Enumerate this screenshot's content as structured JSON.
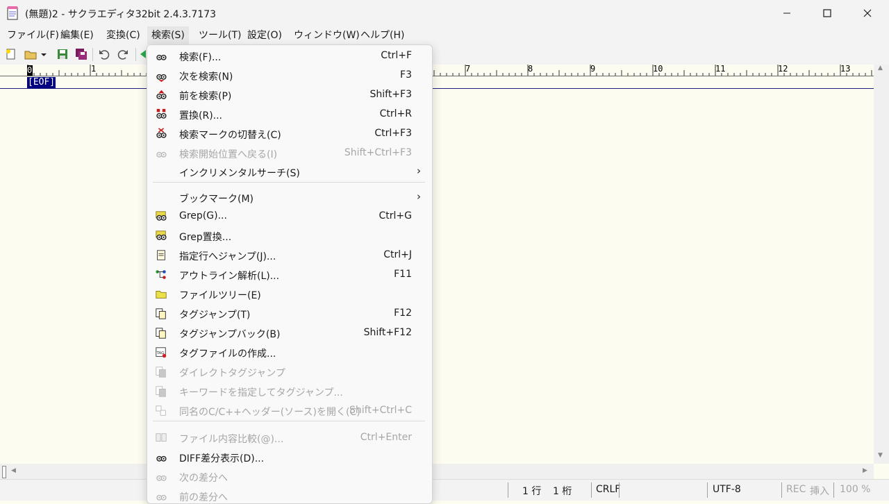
{
  "window": {
    "title": "(無題)2 - サクラエディタ32bit 2.4.3.7173",
    "minimize_icon": "minimize-icon",
    "maximize_icon": "maximize-icon",
    "close_icon": "close-icon"
  },
  "menubar": {
    "items": [
      "ファイル(F)",
      "編集(E)",
      "変換(C)",
      "検索(S)",
      "ツール(T)",
      "設定(O)",
      "ウィンドウ(W)",
      "ヘルプ(H)"
    ],
    "active_index": 3
  },
  "toolbar": {
    "icons": [
      "new-file-icon",
      "open-file-icon",
      "dropdown-arrow-icon",
      "save-icon",
      "save-all-icon",
      "undo-icon",
      "redo-icon",
      "jump-back-icon"
    ]
  },
  "ruler": {
    "cursor_label": "0",
    "labels": [
      "1",
      "7",
      "8",
      "9",
      "10",
      "11",
      "12",
      "13"
    ]
  },
  "editor": {
    "eof_marker": "[EOF]",
    "background": "#fdfcf0",
    "eof_bg": "#000080"
  },
  "search_menu": {
    "items": [
      {
        "label": "検索(F)...",
        "shortcut": "Ctrl+F",
        "icon": "find-icon",
        "enabled": true
      },
      {
        "label": "次を検索(N)",
        "shortcut": "F3",
        "icon": "find-next-icon",
        "enabled": true
      },
      {
        "label": "前を検索(P)",
        "shortcut": "Shift+F3",
        "icon": "find-prev-icon",
        "enabled": true
      },
      {
        "label": "置換(R)...",
        "shortcut": "Ctrl+R",
        "icon": "replace-icon",
        "enabled": true
      },
      {
        "label": "検索マークの切替え(C)",
        "shortcut": "Ctrl+F3",
        "icon": "toggle-search-mark-icon",
        "enabled": true
      },
      {
        "label": "検索開始位置へ戻る(I)",
        "shortcut": "Shift+Ctrl+F3",
        "icon": "search-start-icon",
        "enabled": false
      },
      {
        "label": "インクリメンタルサーチ(S)",
        "shortcut": "",
        "icon": "",
        "enabled": true,
        "submenu": true
      },
      {
        "label": "ブックマーク(M)",
        "shortcut": "",
        "icon": "",
        "enabled": true,
        "submenu": true
      },
      {
        "label": "Grep(G)...",
        "shortcut": "Ctrl+G",
        "icon": "grep-icon",
        "enabled": true
      },
      {
        "label": "Grep置換...",
        "shortcut": "",
        "icon": "grep-replace-icon",
        "enabled": true
      },
      {
        "label": "指定行へジャンプ(J)...",
        "shortcut": "Ctrl+J",
        "icon": "jump-line-icon",
        "enabled": true
      },
      {
        "label": "アウトライン解析(L)...",
        "shortcut": "F11",
        "icon": "outline-icon",
        "enabled": true
      },
      {
        "label": "ファイルツリー(E)",
        "shortcut": "",
        "icon": "file-tree-icon",
        "enabled": true
      },
      {
        "label": "タグジャンプ(T)",
        "shortcut": "F12",
        "icon": "tag-jump-icon",
        "enabled": true
      },
      {
        "label": "タグジャンプバック(B)",
        "shortcut": "Shift+F12",
        "icon": "tag-jump-back-icon",
        "enabled": true
      },
      {
        "label": "タグファイルの作成...",
        "shortcut": "",
        "icon": "tag-file-icon",
        "enabled": true
      },
      {
        "label": "ダイレクトタグジャンプ",
        "shortcut": "",
        "icon": "direct-tag-jump-icon",
        "enabled": false
      },
      {
        "label": "キーワードを指定してタグジャンプ...",
        "shortcut": "",
        "icon": "keyword-tag-jump-icon",
        "enabled": false
      },
      {
        "label": "同名のC/C++ヘッダー(ソース)を開く(C)",
        "shortcut": "Shift+Ctrl+C",
        "icon": "open-header-icon",
        "enabled": false
      },
      {
        "label": "ファイル内容比較(@)...",
        "shortcut": "Ctrl+Enter",
        "icon": "compare-icon",
        "enabled": false
      },
      {
        "label": "DIFF差分表示(D)...",
        "shortcut": "",
        "icon": "diff-icon",
        "enabled": true
      },
      {
        "label": "次の差分へ",
        "shortcut": "",
        "icon": "next-diff-icon",
        "enabled": false
      },
      {
        "label": "前の差分へ",
        "shortcut": "",
        "icon": "prev-diff-icon",
        "enabled": false
      }
    ]
  },
  "statusbar": {
    "line": "1 行",
    "column": "1 桁",
    "eol": "CRLF",
    "encoding": "UTF-8",
    "rec": "REC",
    "insert_mode": "挿入",
    "zoom": "100 %"
  }
}
